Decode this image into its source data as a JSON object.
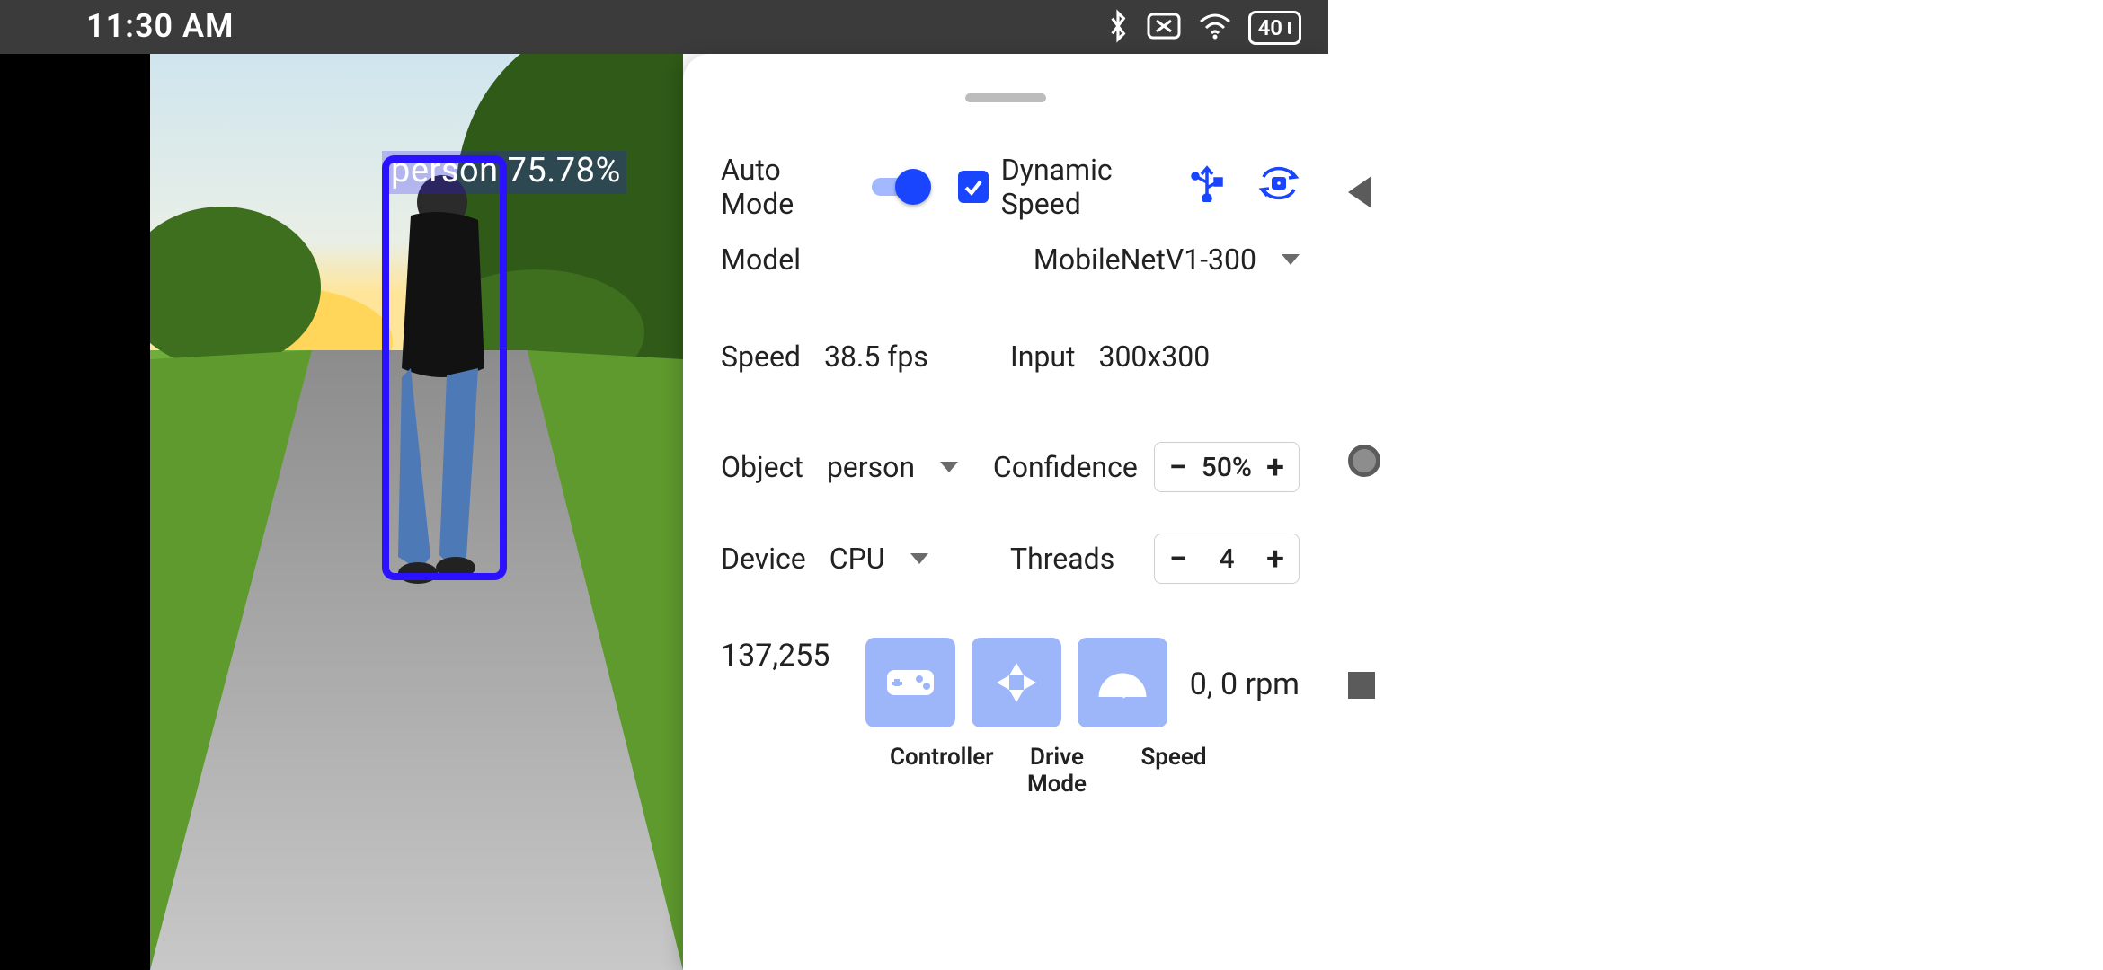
{
  "status": {
    "time": "11:30 AM",
    "battery": "40"
  },
  "detection": {
    "class": "person",
    "confidence_pct": "75.78%"
  },
  "panel": {
    "auto_mode_label": "Auto Mode",
    "dynamic_speed_label": "Dynamic Speed",
    "model_label": "Model",
    "model_value": "MobileNetV1-300",
    "speed_label": "Speed",
    "speed_value": "38.5 fps",
    "input_label": "Input",
    "input_value": "300x300",
    "object_label": "Object",
    "object_value": "person",
    "confidence_label": "Confidence",
    "confidence_value": "50%",
    "device_label": "Device",
    "device_value": "CPU",
    "threads_label": "Threads",
    "threads_value": "4",
    "motor_pair": "137,255",
    "rpm_text": "0,  0 rpm",
    "btn_controller": "Controller",
    "btn_drivemode": "Drive Mode",
    "btn_speed": "Speed"
  }
}
